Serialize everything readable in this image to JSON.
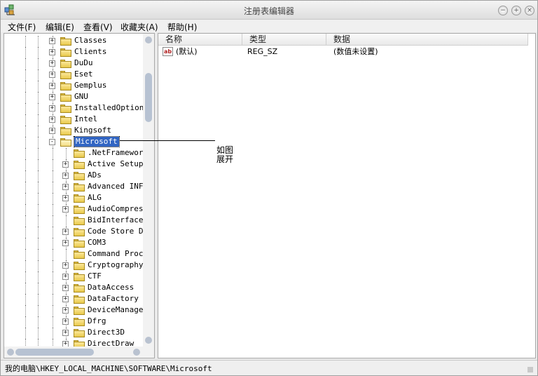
{
  "window": {
    "title": "注册表编辑器",
    "controls": [
      "minimize-icon",
      "maximize-icon",
      "close-icon"
    ]
  },
  "menu": {
    "file": "文件(F)",
    "edit": "编辑(E)",
    "view": "查看(V)",
    "favorites": "收藏夹(A)",
    "help": "帮助(H)"
  },
  "tree": {
    "items": [
      {
        "label": "Classes",
        "expander": "+"
      },
      {
        "label": "Clients",
        "expander": "+"
      },
      {
        "label": "DuDu",
        "expander": "+"
      },
      {
        "label": "Eset",
        "expander": "+"
      },
      {
        "label": "Gemplus",
        "expander": "+"
      },
      {
        "label": "GNU",
        "expander": "+"
      },
      {
        "label": "InstalledOptions",
        "expander": "+"
      },
      {
        "label": "Intel",
        "expander": "+"
      },
      {
        "label": "Kingsoft",
        "expander": "+"
      },
      {
        "label": "Microsoft",
        "expander": "-",
        "selected": true
      },
      {
        "label": ".NetFramework",
        "expander": ""
      },
      {
        "label": "Active Setup",
        "expander": "+"
      },
      {
        "label": "ADs",
        "expander": "+"
      },
      {
        "label": "Advanced INF",
        "expander": "+"
      },
      {
        "label": "ALG",
        "expander": "+"
      },
      {
        "label": "AudioCompress",
        "expander": "+"
      },
      {
        "label": "BidInterface",
        "expander": ""
      },
      {
        "label": "Code Store Da",
        "expander": "+"
      },
      {
        "label": "COM3",
        "expander": "+"
      },
      {
        "label": "Command Proce",
        "expander": ""
      },
      {
        "label": "Cryptography",
        "expander": "+"
      },
      {
        "label": "CTF",
        "expander": "+"
      },
      {
        "label": "DataAccess",
        "expander": "+"
      },
      {
        "label": "DataFactory",
        "expander": "+"
      },
      {
        "label": "DeviceManager",
        "expander": "+"
      },
      {
        "label": "Dfrg",
        "expander": "+"
      },
      {
        "label": "Direct3D",
        "expander": "+"
      },
      {
        "label": "DirectDraw",
        "expander": "+"
      }
    ]
  },
  "list": {
    "columns": {
      "name": "名称",
      "type": "类型",
      "data": "数据"
    },
    "rows": [
      {
        "name": "(默认)",
        "type": "REG_SZ",
        "data": "(数值未设置)",
        "icon": "ab"
      }
    ]
  },
  "annotation": {
    "line1": "如图",
    "line2": "展开"
  },
  "status": {
    "path": "我的电脑\\HKEY_LOCAL_MACHINE\\SOFTWARE\\Microsoft"
  }
}
